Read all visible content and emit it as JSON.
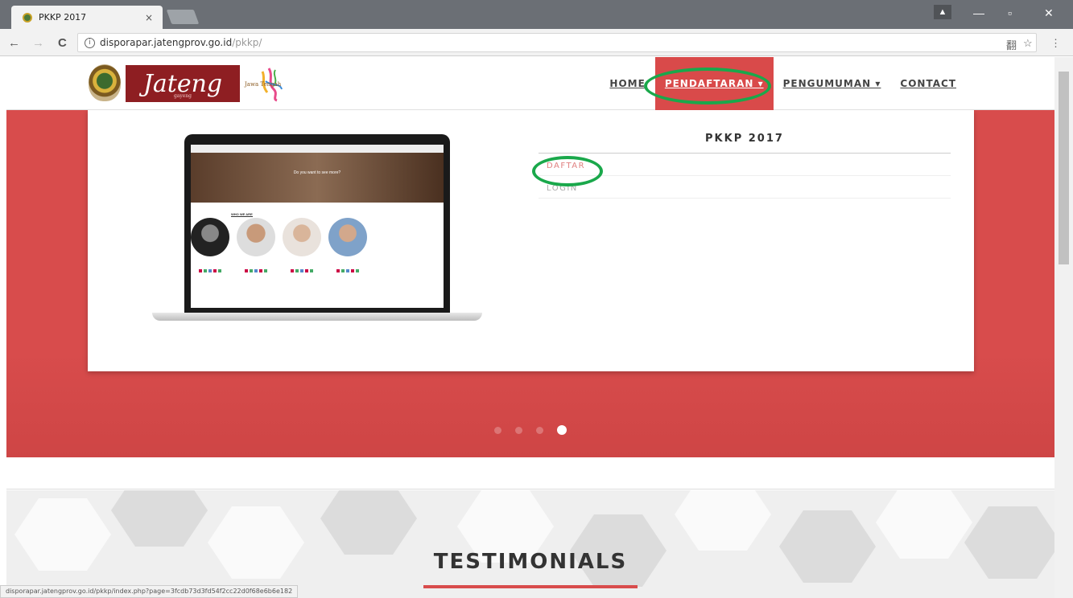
{
  "browser": {
    "tab_title": "PKKP 2017",
    "tab_close": "×",
    "url_host": "disporapar.jatengprov.go.id",
    "url_path": "/pkkp/",
    "back": "←",
    "forward": "→",
    "reload": "C",
    "info": "ⓘ",
    "translate": "翻",
    "star": "☆",
    "menu": "⋮",
    "minimize": "—",
    "maximize": "▫",
    "close": "✕",
    "profile": "▲",
    "status_url": "disporapar.jatengprov.go.id/pkkp/index.php?page=3fcdb73d3fd54f2cc22d0f68e6b6e182"
  },
  "header": {
    "logo_text": "Jateng",
    "logo_sub": "gayeng",
    "tagline": "Jawa Tengah",
    "nav": {
      "home": "HOME",
      "pendaftaran": "PENDAFTARAN ▾",
      "pengumuman": "PENGUMUMAN ▾",
      "contact": "CONTACT"
    }
  },
  "hero": {
    "laptop_heading": "Do you want to see more?",
    "laptop_section": "WHO WE ARE",
    "panel_title": "PKKP 2017",
    "items": [
      {
        "label": "DAFTAR"
      },
      {
        "label": "LOGIN"
      }
    ],
    "slide_count": 4,
    "active_slide": 4
  },
  "testimonials": {
    "title": "TESTIMONIALS"
  },
  "colors": {
    "accent": "#d84c4c",
    "highlight_ring": "#1aa84b",
    "logo_bg": "#8e1e22"
  }
}
